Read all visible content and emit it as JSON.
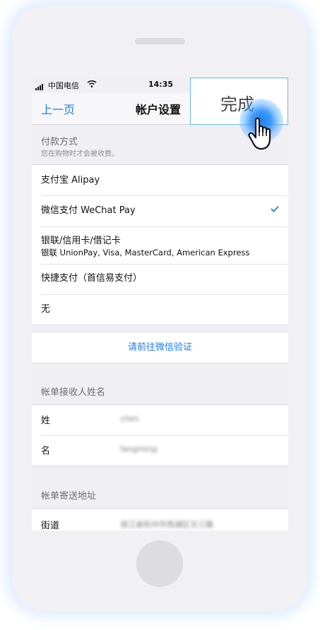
{
  "status_bar": {
    "carrier": "中国电信",
    "time": "14:35"
  },
  "nav": {
    "back_label": "上一页",
    "title": "帐户设置"
  },
  "payment": {
    "header": "付款方式",
    "subheader": "您在购物时才会被收费。",
    "options": [
      {
        "label": "支付宝 Alipay",
        "selected": false
      },
      {
        "label": "微信支付 WeChat Pay",
        "selected": true
      },
      {
        "label": "银联/信用卡/借记卡",
        "sublabel": "银联 UnionPay, Visa, MasterCard, American Express",
        "selected": false
      },
      {
        "label": "快捷支付（首信易支付）",
        "selected": false
      },
      {
        "label": "无",
        "selected": false
      }
    ]
  },
  "verify_link": "请前往微信验证",
  "recipient": {
    "header": "帐单接收人姓名",
    "rows": [
      {
        "label": "姓",
        "value": "chen"
      },
      {
        "label": "名",
        "value": "fangming"
      }
    ]
  },
  "address": {
    "header": "帐单寄送地址",
    "rows": [
      {
        "label": "街道",
        "value": "浙江省杭州市西湖区文三路"
      }
    ]
  },
  "popup": {
    "done_label": "完成"
  },
  "colors": {
    "accent": "#1c7cf5",
    "popup_border": "#6bb6ee"
  }
}
